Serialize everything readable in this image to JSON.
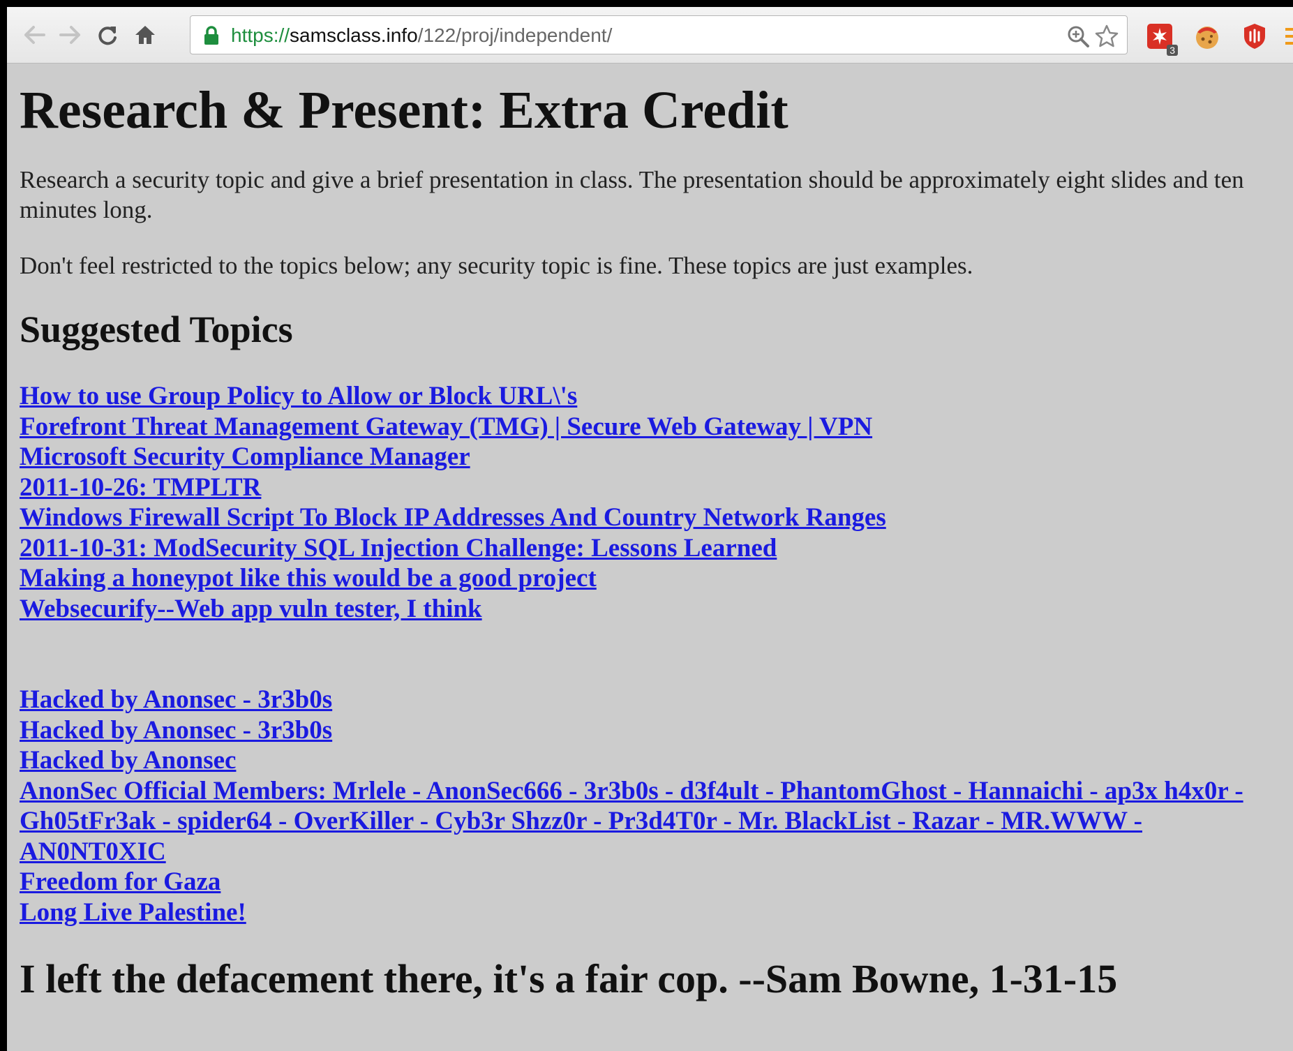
{
  "browser": {
    "url_scheme": "https://",
    "url_host": "samsclass.info",
    "url_path": "/122/proj/independent/",
    "extension_badge": "3"
  },
  "page": {
    "title": "Research & Present: Extra Credit",
    "paragraph1": "Research a security topic and give a brief presentation in class. The presentation should be approximately eight slides and ten minutes long.",
    "paragraph2": "Don't feel restricted to the topics below; any security topic is fine. These topics are just examples.",
    "subheading": "Suggested Topics",
    "topics": [
      "How to use Group Policy to Allow or Block URL\\'s",
      "Forefront Threat Management Gateway (TMG) | Secure Web Gateway | VPN",
      "Microsoft Security Compliance Manager",
      "2011-10-26: TMPLTR",
      "Windows Firewall Script To Block IP Addresses And Country Network Ranges",
      "2011-10-31: ModSecurity SQL Injection Challenge: Lessons Learned",
      "Making a honeypot like this would be a good project",
      "Websecurify--Web app vuln tester, I think"
    ],
    "defacement_links": [
      "Hacked by Anonsec - 3r3b0s",
      "Hacked by Anonsec - 3r3b0s",
      "Hacked by Anonsec",
      "AnonSec Official Members: Mrlele - AnonSec666 - 3r3b0s - d3f4ult - PhantomGhost - Hannaichi - ap3x h4x0r - Gh05tFr3ak - spider64 - OverKiller - Cyb3r Shzz0r - Pr3d4T0r - Mr. BlackList - Razar - MR.WWW - AN0NT0XIC",
      "Freedom for Gaza",
      "Long Live Palestine!"
    ],
    "footer": "I left the defacement there, it's a fair cop. --Sam Bowne, 1-31-15"
  }
}
